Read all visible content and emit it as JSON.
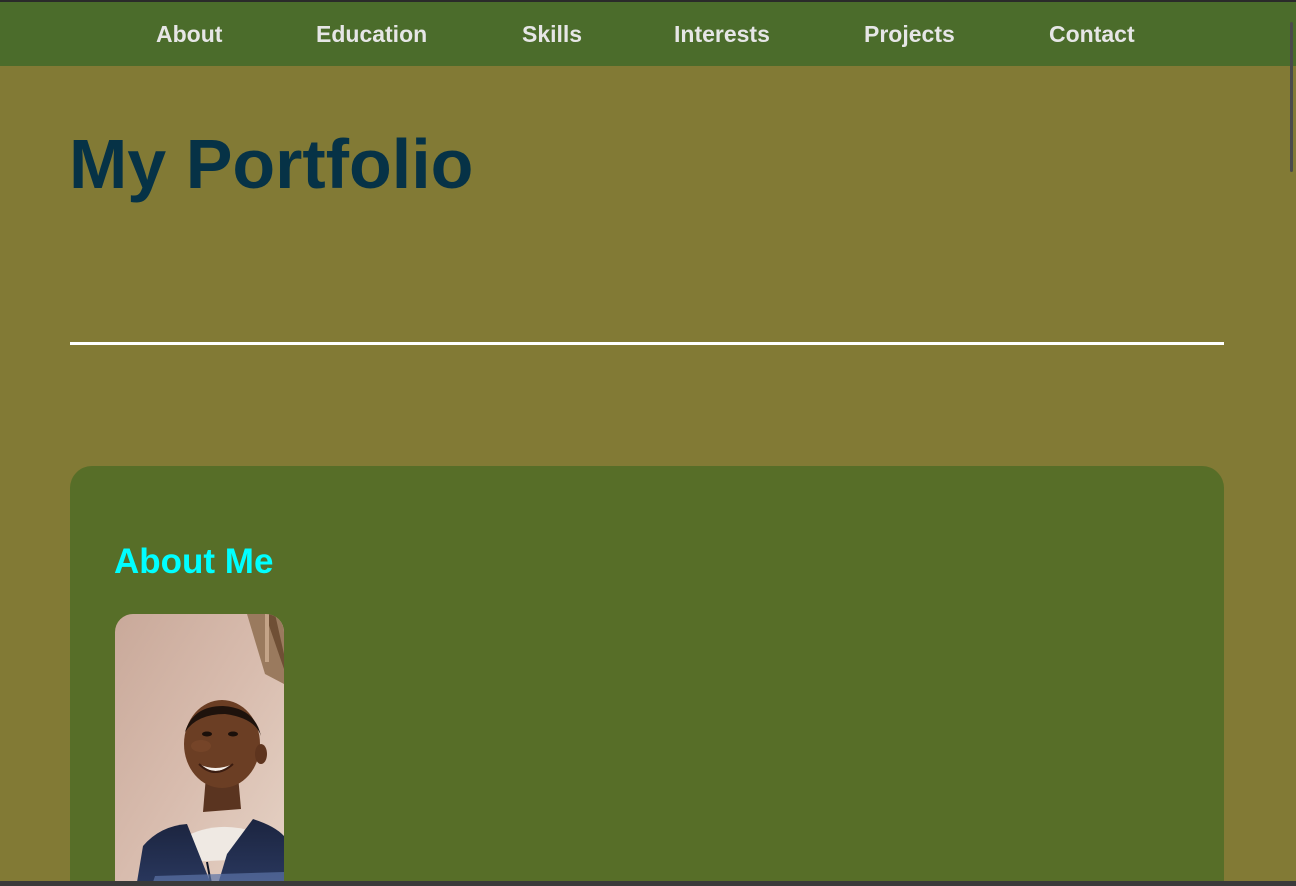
{
  "nav": {
    "items": [
      {
        "label": "About"
      },
      {
        "label": "Education"
      },
      {
        "label": "Skills"
      },
      {
        "label": "Interests"
      },
      {
        "label": "Projects"
      },
      {
        "label": "Contact"
      }
    ]
  },
  "header": {
    "title": "My Portfolio"
  },
  "about": {
    "heading": "About Me",
    "photo_icon": "profile-photo"
  },
  "colors": {
    "nav_background": "#4b6c2b",
    "page_background": "#827a35",
    "card_background": "#576e28",
    "title_color": "#063246",
    "heading_color": "#00ffff",
    "nav_text": "#e6e6e6"
  }
}
